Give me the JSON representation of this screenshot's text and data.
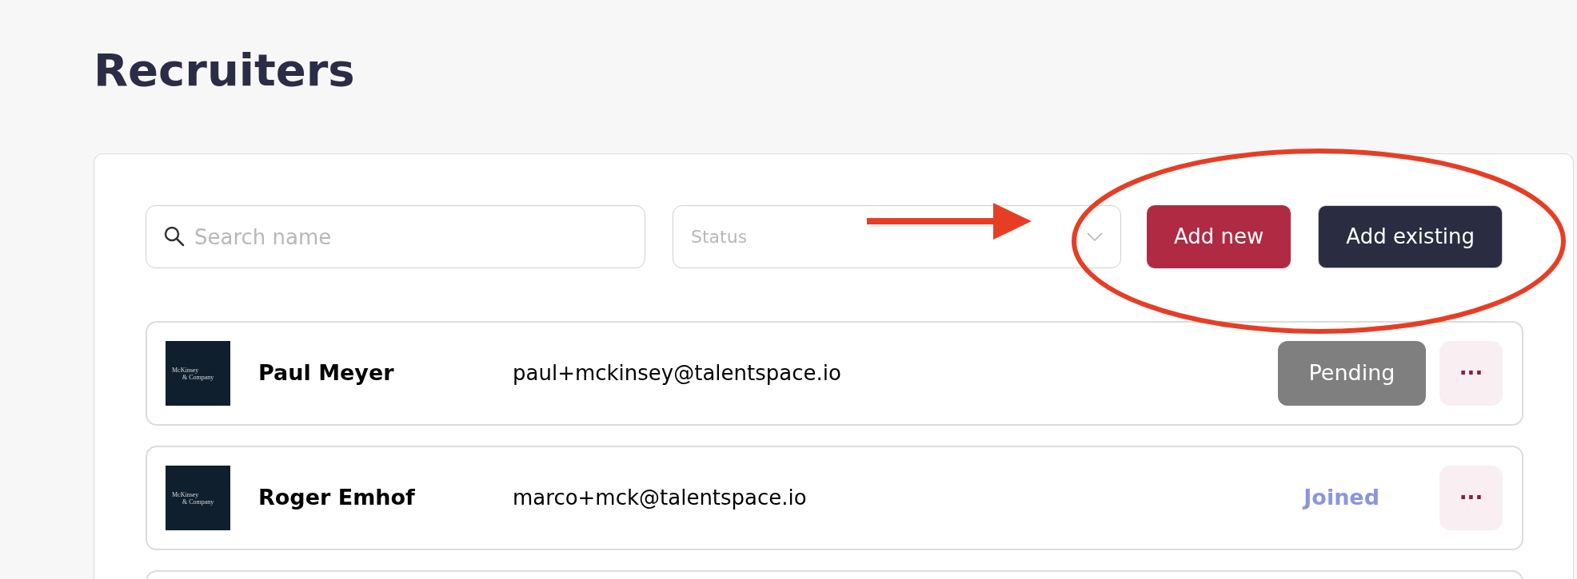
{
  "page_title": "Recruiters",
  "search": {
    "placeholder": "Search name"
  },
  "status_filter": {
    "placeholder": "Status"
  },
  "actions": [
    {
      "label": "Add new",
      "kind": "primary"
    },
    {
      "label": "Add existing",
      "kind": "secondary"
    }
  ],
  "rows": [
    {
      "logo_lines": [
        "McKinsey",
        "& Company"
      ],
      "name": "Paul Meyer",
      "email": "paul+mckinsey@talentspace.io",
      "status": "Pending",
      "kind": "pending",
      "menu": "···"
    },
    {
      "logo_lines": [
        "McKinsey",
        "& Company"
      ],
      "name": "Roger Emhof",
      "email": "marco+mck@talentspace.io",
      "status": "Joined",
      "kind": "joined",
      "menu": "···"
    }
  ]
}
